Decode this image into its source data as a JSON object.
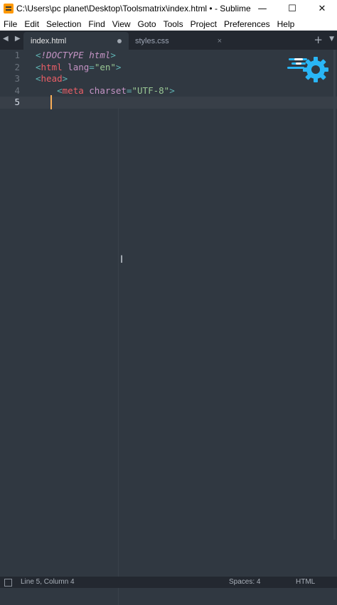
{
  "window": {
    "title": "C:\\Users\\pc planet\\Desktop\\Toolsmatrix\\index.html • - Sublime Text (U...",
    "minimize_glyph": "—",
    "maximize_glyph": "☐",
    "close_glyph": "✕"
  },
  "menu": [
    "File",
    "Edit",
    "Selection",
    "Find",
    "View",
    "Goto",
    "Tools",
    "Project",
    "Preferences",
    "Help"
  ],
  "tabs": [
    {
      "label": "index.html",
      "active": true,
      "modified": true
    },
    {
      "label": "styles.css",
      "active": false,
      "close_glyph": "×"
    }
  ],
  "tabbar": {
    "nav_arrows": "◀ ▶",
    "new_tab": "+",
    "dropdown": "▼"
  },
  "editor": {
    "line_numbers": [
      "1",
      "2",
      "3",
      "4",
      "5"
    ],
    "current_line": 5,
    "lines": [
      {
        "indent": "",
        "tokens": [
          [
            "punct",
            "<"
          ],
          [
            "kw",
            "!DOCTYPE html"
          ],
          [
            "punct",
            ">"
          ]
        ]
      },
      {
        "indent": "",
        "tokens": [
          [
            "punct",
            "<"
          ],
          [
            "tag",
            "html"
          ],
          [
            "plain",
            " "
          ],
          [
            "attr",
            "lang"
          ],
          [
            "punct",
            "="
          ],
          [
            "str",
            "\"en\""
          ],
          [
            "punct",
            ">"
          ]
        ]
      },
      {
        "indent": "",
        "tokens": [
          [
            "punct",
            "<"
          ],
          [
            "tag",
            "head"
          ],
          [
            "punct",
            ">"
          ]
        ]
      },
      {
        "indent": "    ",
        "tokens": [
          [
            "punct",
            "<"
          ],
          [
            "tag",
            "meta"
          ],
          [
            "plain",
            " "
          ],
          [
            "attr",
            "charset"
          ],
          [
            "punct",
            "="
          ],
          [
            "str",
            "\"UTF-8\""
          ],
          [
            "punct",
            ">"
          ]
        ]
      },
      {
        "indent": "    ",
        "tokens": []
      }
    ],
    "cursor_glyph": "I"
  },
  "status": {
    "position": "Line 5, Column 4",
    "spaces": "Spaces: 4",
    "syntax": "HTML"
  },
  "colors": {
    "editor_bg": "#303841",
    "tabbar_bg": "#232830",
    "caret": "#f9ae58",
    "logo_accent": "#29b6f6"
  }
}
